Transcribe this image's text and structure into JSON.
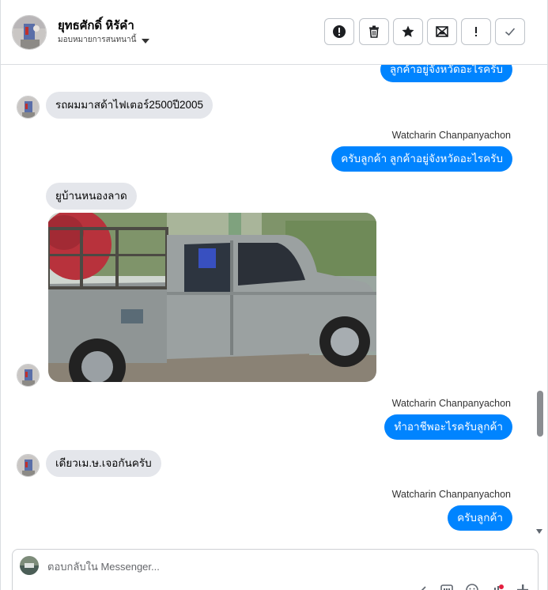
{
  "header": {
    "contact_name": "ยุทธศักดิ์ หิรัคำ",
    "assign_label": "มอบหมายการสนทนานี้",
    "actions": [
      "mark-spam",
      "delete",
      "star",
      "mark-unread",
      "follow-up",
      "done"
    ]
  },
  "messages": [
    {
      "type": "outgoing",
      "text": "ลูกค้าอยู่จังหวัดอะไรครับ"
    },
    {
      "type": "incoming",
      "text": "รถผมมาสด้าไฟเตอร์2500ปี2005"
    },
    {
      "type": "outgoing",
      "sender": "Watcharin Chanpanyachon",
      "text": "ครับลูกค้า  ลูกค้าอยู่จังหวัดอะไรครับ"
    },
    {
      "type": "incoming",
      "text": "ยูบ้านหนองลาด"
    },
    {
      "type": "incoming-image",
      "image": "grey-pickup-truck-photo"
    },
    {
      "type": "outgoing",
      "sender": "Watcharin Chanpanyachon",
      "text": "ทำอาชีพอะไรครับลูกค้า"
    },
    {
      "type": "incoming",
      "text": "เดียวเม.ษ.เจอกันครับ"
    },
    {
      "type": "outgoing",
      "sender": "Watcharin Chanpanyachon",
      "text": "ครับลูกค้า"
    }
  ],
  "composer": {
    "placeholder": "ตอบกลับใน Messenger...",
    "tools": [
      "attach-icon",
      "gif-icon",
      "emoji-icon",
      "thumbs-up-icon",
      "add-icon"
    ]
  },
  "colors": {
    "outgoing_bubble": "#0084ff",
    "incoming_bubble": "#e4e6eb",
    "border": "#dadde1"
  }
}
